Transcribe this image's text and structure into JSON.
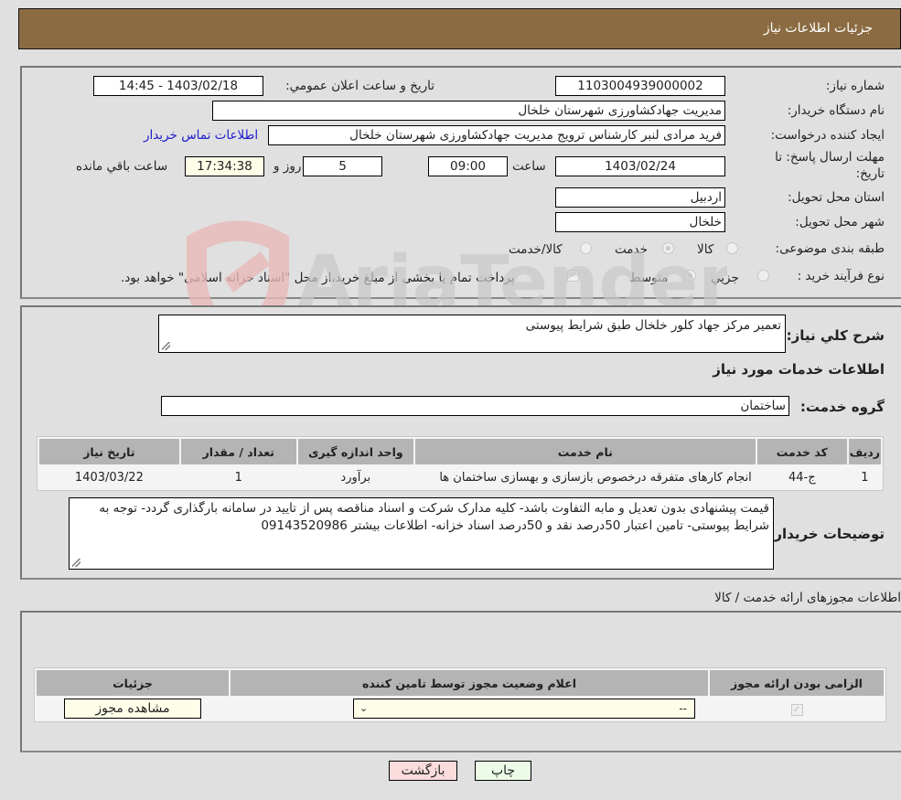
{
  "header": {
    "title": "جزئیات اطلاعات نیاز"
  },
  "details": {
    "need_number_label": "شماره نیاز:",
    "need_number": "1103004939000002",
    "announce_label": "تاریخ و ساعت اعلان عمومي:",
    "announce_value": "1403/02/18 - 14:45",
    "buyer_org_label": "نام دستگاه خریدار:",
    "buyer_org": "مدیریت جهادکشاورزی شهرستان خلخال",
    "creator_label": "ایجاد کننده درخواست:",
    "creator": "فرید مرادی لنبر کارشناس ترویج مدیریت جهادکشاورزی شهرستان خلخال",
    "contact_link": "اطلاعات تماس خریدار",
    "deadline_label_1": "مهلت ارسال پاسخ: تا",
    "deadline_label_2": "تاریخ:",
    "deadline_date": "1403/02/24",
    "time_label": "ساعت",
    "deadline_time": "09:00",
    "days_value": "5",
    "days_label": "روز و",
    "remaining_time": "17:34:38",
    "remaining_label": "ساعت باقي مانده",
    "province_label": "استان محل تحویل:",
    "province": "اردبیل",
    "city_label": "شهر محل تحویل:",
    "city": "خلخال",
    "category_label": "طبقه بندی موضوعی:",
    "category_options": [
      {
        "label": "کالا",
        "checked": false
      },
      {
        "label": "خدمت",
        "checked": true
      },
      {
        "label": "کالا/خدمت",
        "checked": false
      }
    ],
    "process_label": "نوع فرآیند خرید :",
    "process_options": [
      {
        "label": "جزيي",
        "checked": false
      },
      {
        "label": "متوسط",
        "checked": true
      }
    ],
    "treasury_note": "پرداخت تمام یا بخشی از مبلغ خرید،از محل \"اسناد خزانه اسلامی\" خواهد بود.",
    "treasury_checked": true
  },
  "services": {
    "description_label": "شرح کلي نیاز:",
    "description": "تعمیر مرکز جهاد کلور خلخال طبق شرایط پیوستی",
    "section_title": "اطلاعات خدمات مورد نیاز",
    "group_label": "گروه خدمت:",
    "group_value": "ساختمان",
    "table": {
      "headers": [
        "ردیف",
        "کد خدمت",
        "نام خدمت",
        "واحد اندازه گیری",
        "تعداد / مقدار",
        "تاریخ نیاز"
      ],
      "rows": [
        [
          "1",
          "ج-44",
          "انجام کارهای متفرقه درخصوص بازسازی و بهسازی ساختمان ها",
          "برآورد",
          "1",
          "1403/03/22"
        ]
      ]
    },
    "buyer_notes_label": "توضیحات خریدار:",
    "buyer_notes": "قیمت پیشنهادی بدون تعدیل و مابه التفاوت باشد- کلیه مدارک شرکت و اسناد مناقصه پس از تایید در سامانه بارگذاری گردد- توجه به شرایط پیوستی- تامین اعتبار 50درصد نقد و 50درصد اسناد خزانه- اطلاعات بیشتر 09143520986"
  },
  "permits": {
    "section_title": "اطلاعات مجوزهای ارائه خدمت / کالا",
    "headers": [
      "الزامی بودن ارائه مجوز",
      "اعلام وضعیت مجوز توسط تامین کننده",
      "جزئیات"
    ],
    "row": {
      "required_checked": true,
      "status_value": "--",
      "details_button": "مشاهده مجوز"
    }
  },
  "actions": {
    "print_label": "چاپ",
    "back_label": "بازگشت"
  },
  "watermark": {
    "text": "AriaTender.neT"
  }
}
